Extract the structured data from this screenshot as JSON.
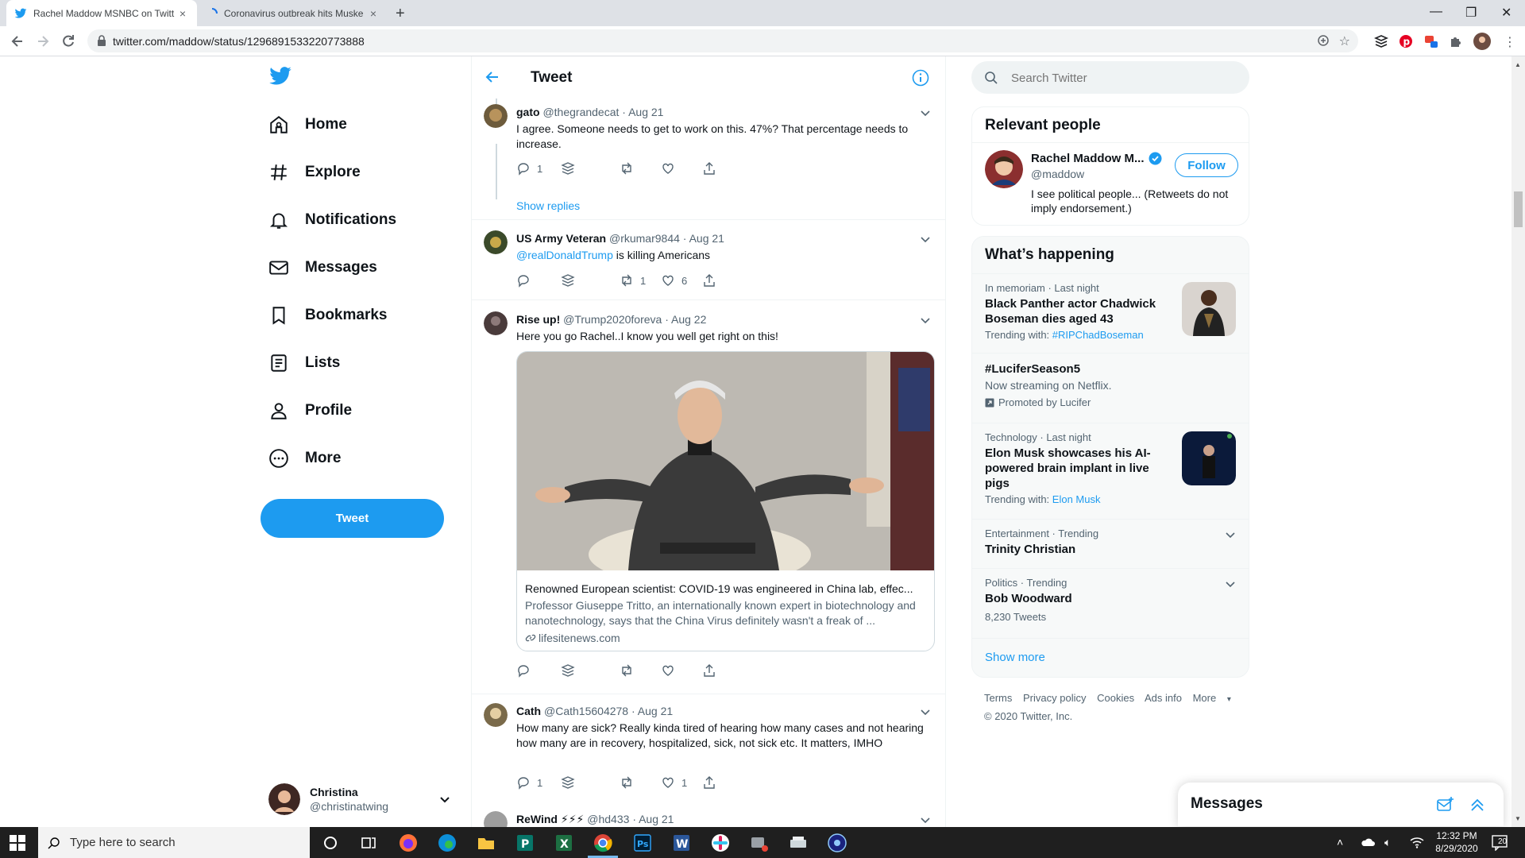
{
  "browser": {
    "tabs": [
      {
        "title": "Rachel Maddow MSNBC on Twitt",
        "active": true
      },
      {
        "title": "Coronavirus outbreak hits Muske",
        "active": false
      }
    ],
    "url": "twitter.com/maddow/status/1296891533220773888"
  },
  "nav": {
    "items": [
      {
        "label": "Home",
        "icon": "home-icon"
      },
      {
        "label": "Explore",
        "icon": "hashtag-icon"
      },
      {
        "label": "Notifications",
        "icon": "bell-icon"
      },
      {
        "label": "Messages",
        "icon": "envelope-icon"
      },
      {
        "label": "Bookmarks",
        "icon": "bookmark-icon"
      },
      {
        "label": "Lists",
        "icon": "list-icon"
      },
      {
        "label": "Profile",
        "icon": "person-icon"
      },
      {
        "label": "More",
        "icon": "more-icon"
      }
    ],
    "tweet_button": "Tweet",
    "account": {
      "name": "Christina",
      "handle": "@christinatwing"
    }
  },
  "main": {
    "title": "Tweet",
    "show_replies": "Show replies",
    "tweets": [
      {
        "name": "gato",
        "handle": "@thegrandecat",
        "date": "· Aug 21",
        "text": "I agree. Someone needs to get to work on this. 47%?  That percentage needs to increase.",
        "replies": "1",
        "retweets": "",
        "likes": ""
      },
      {
        "name": "US Army Veteran",
        "handle": "@rkumar9844",
        "date": "· Aug 21",
        "mention": "@realDonaldTrump",
        "text": " is killing Americans",
        "replies": "",
        "retweets": "1",
        "likes": "6"
      },
      {
        "name": "Rise up!",
        "handle": "@Trump2020foreva",
        "date": "· Aug 22",
        "text": "Here you go Rachel..I know you well get right on this!",
        "card": {
          "title": "Renowned European scientist: COVID-19 was engineered in China lab, effec...",
          "desc": "Professor Giuseppe Tritto, an internationally known expert in biotechnology and nanotechnology, says that the China Virus definitely wasn't a freak of ...",
          "domain": "lifesitenews.com"
        },
        "replies": "",
        "retweets": "",
        "likes": ""
      },
      {
        "name": "Cath",
        "handle": "@Cath15604278",
        "date": "· Aug 21",
        "text": "How many are sick? Really kinda tired of hearing how many cases and not hearing  how many are in recovery,  hospitalized,  sick, not sick etc.  It matters, IMHO",
        "replies": "1",
        "retweets": "",
        "likes": "1"
      },
      {
        "name": "ReWind ⚡⚡⚡",
        "handle": "@hd433",
        "date": "· Aug 21"
      }
    ]
  },
  "right": {
    "search_placeholder": "Search Twitter",
    "relevant_title": "Relevant people",
    "person": {
      "name": "Rachel Maddow M...",
      "handle": "@maddow",
      "bio": "I see political people... (Retweets do not imply endorsement.)",
      "follow": "Follow"
    },
    "happening_title": "What’s happening",
    "trends": [
      {
        "meta": "In memoriam · Last night",
        "title": "Black Panther actor Chadwick Boseman dies aged 43",
        "sub_prefix": "Trending with: ",
        "sub_link": "#RIPChadBoseman"
      },
      {
        "meta": "",
        "title": "#LuciferSeason5",
        "desc": "Now streaming on Netflix.",
        "promo": "Promoted by Lucifer"
      },
      {
        "meta": "Technology · Last night",
        "title": "Elon Musk showcases his AI-powered brain implant in live pigs",
        "sub_prefix": "Trending with: ",
        "sub_link": "Elon Musk"
      },
      {
        "meta": "Entertainment · Trending",
        "title": "Trinity Christian"
      },
      {
        "meta": "Politics · Trending",
        "title": "Bob Woodward",
        "count": "8,230 Tweets"
      }
    ],
    "show_more": "Show more",
    "footer": [
      "Terms",
      "Privacy policy",
      "Cookies",
      "Ads info",
      "More"
    ],
    "copyright": "© 2020 Twitter, Inc.",
    "messages_drawer": "Messages"
  },
  "taskbar": {
    "search_placeholder": "Type here to search",
    "time": "12:32 PM",
    "date": "8/29/2020",
    "notif_count": "20"
  },
  "colors": {
    "accent": "#1d9bf0",
    "text": "#0f1419",
    "muted": "#536471"
  }
}
